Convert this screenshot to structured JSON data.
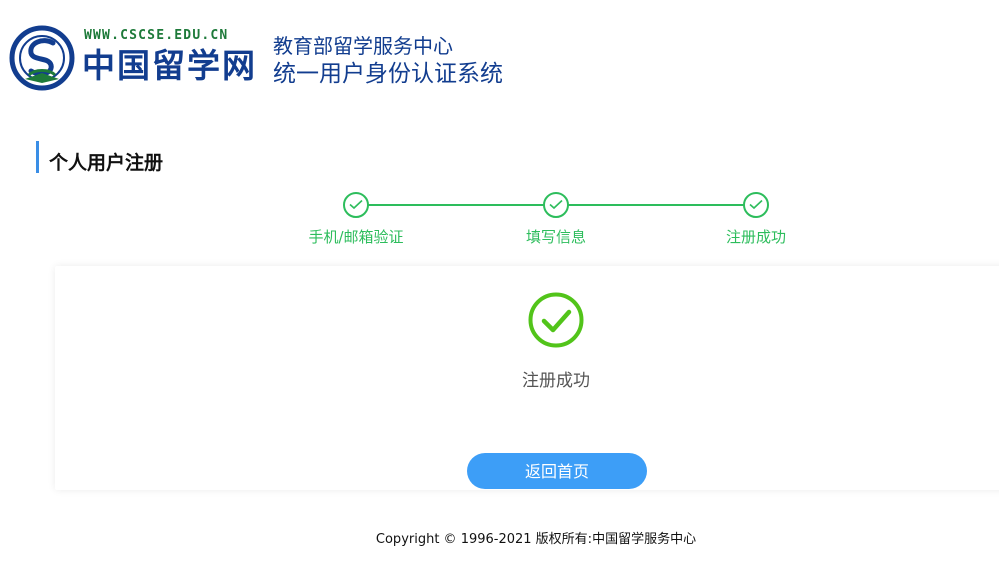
{
  "header": {
    "logo_url_text": "WWW.CSCSE.EDU.CN",
    "logo_name": "中国留学网",
    "system_title_line1": "教育部留学服务中心",
    "system_title_line2": "统一用户身份认证系统"
  },
  "page": {
    "heading": "个人用户注册"
  },
  "steps": [
    {
      "label": "手机/邮箱验证",
      "status": "completed",
      "icon": "check-icon"
    },
    {
      "label": "填写信息",
      "status": "completed",
      "icon": "check-icon"
    },
    {
      "label": "注册成功",
      "status": "completed",
      "icon": "check-icon"
    }
  ],
  "result": {
    "icon": "success-check-icon",
    "message": "注册成功",
    "button_label": "返回首页"
  },
  "footer": {
    "copyright": "Copyright © 1996-2021 版权所有:中国留学服务中心"
  },
  "colors": {
    "brand_blue": "#123d8f",
    "success_green": "#2dbd5c",
    "accent_blue": "#3d9ef7"
  }
}
